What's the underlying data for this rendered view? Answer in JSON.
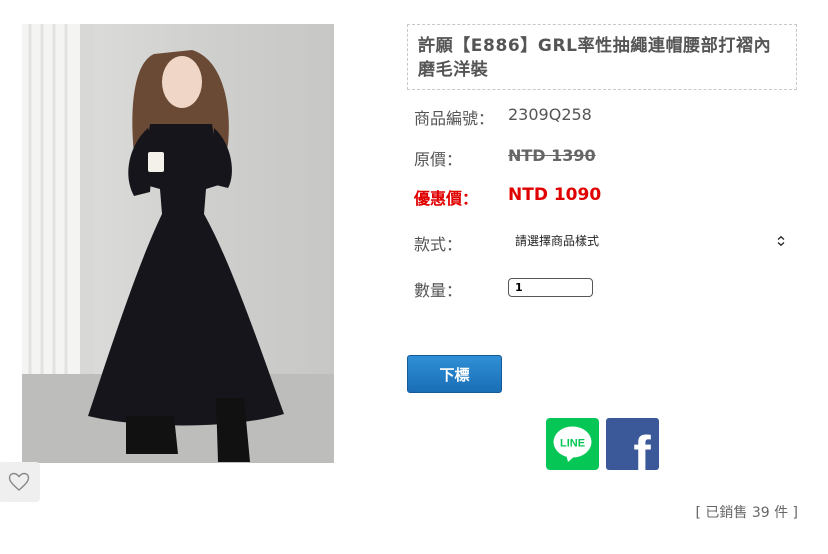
{
  "product": {
    "title": "許願【E886】GRL率性抽繩連帽腰部打褶內磨毛洋裝",
    "code_label": "商品編號：",
    "code": "2309Q258",
    "original_price_label": "原價：",
    "original_price": "NTD 1390",
    "sale_price_label": "優惠價：",
    "sale_price": "NTD 1090",
    "style_label": "款式：",
    "style_select_value": "請選擇商品樣式",
    "qty_label": "數量：",
    "qty_value": "1",
    "bid_button": "下標",
    "share_line": "LINE",
    "share_facebook": "f",
    "sold_text": "[ 已銷售 39 件 ]"
  },
  "icons": {
    "favorite": "heart-outline-icon",
    "select_chevron": "chevron-updown-icon"
  },
  "colors": {
    "sale_red": "#e00000",
    "bid_button_blue": "#1a6eb6",
    "line_green": "#06c755",
    "facebook_blue": "#3b5998"
  }
}
